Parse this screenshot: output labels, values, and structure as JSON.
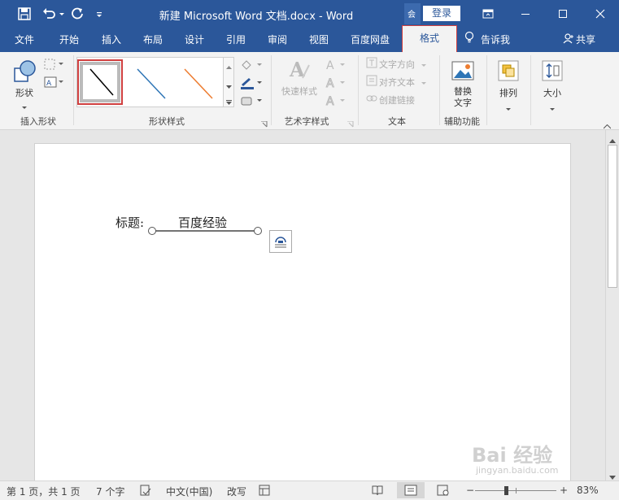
{
  "titlebar": {
    "title": "新建 Microsoft Word 文档.docx  -  Word",
    "login": "登录",
    "account_icon_text": "会"
  },
  "tabs": [
    {
      "label": "文件"
    },
    {
      "label": "开始"
    },
    {
      "label": "插入"
    },
    {
      "label": "布局"
    },
    {
      "label": "设计"
    },
    {
      "label": "引用"
    },
    {
      "label": "审阅"
    },
    {
      "label": "视图"
    },
    {
      "label": "百度网盘"
    },
    {
      "label": "格式",
      "active": true
    }
  ],
  "tell_me": "告诉我",
  "share": "共享",
  "ribbon": {
    "shape_btn": "形状",
    "group_insert_shape": "插入形状",
    "group_shape_styles": "形状样式",
    "quick_styles": "快速样式",
    "group_wordart": "艺术字样式",
    "text_direction": "文字方向",
    "align_text": "对齐文本",
    "create_link": "创建链接",
    "group_text": "文本",
    "alt_text_line1": "替换",
    "alt_text_line2": "文字",
    "group_accessibility": "辅助功能",
    "arrange": "排列",
    "size": "大小",
    "line_colors": [
      "#000000",
      "#2e75b6",
      "#ed7d31"
    ]
  },
  "document": {
    "label": "标题:",
    "title_text": "百度经验"
  },
  "statusbar": {
    "page": "第 1 页，共 1 页",
    "words": "7 个字",
    "language": "中文(中国)",
    "mode": "改写",
    "zoom": "83%",
    "zoom_minus": "−",
    "zoom_plus": "+"
  },
  "watermark": {
    "main": "Bai 经验",
    "sub": "jingyan.baidu.com"
  }
}
